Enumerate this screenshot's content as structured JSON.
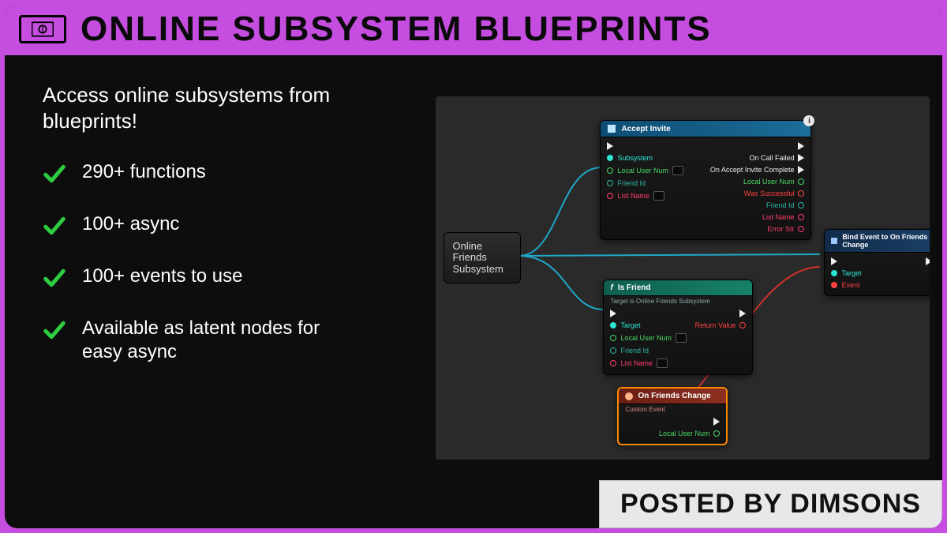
{
  "header": {
    "title": "ONLINE SUBSYSTEM BLUEPRINTS"
  },
  "tagline": "Access online subsystems from blueprints!",
  "features": [
    "290+ functions",
    "100+ async",
    "100+ events to use",
    "Available as latent nodes for easy async"
  ],
  "watermark": "POSTED BY DIMSONS",
  "graph": {
    "source_node": {
      "line1": "Online",
      "line2": "Friends",
      "line3": "Subsystem"
    },
    "accept": {
      "title": "Accept Invite",
      "in": [
        "Subsystem",
        "Local User Num",
        "Friend Id",
        "List Name"
      ],
      "out": [
        "On Call Failed",
        "On Accept Invite Complete",
        "Local User Num",
        "Was Successful",
        "Friend Id",
        "List Name",
        "Error Str"
      ]
    },
    "isfriend": {
      "title": "Is Friend",
      "sub": "Target is Online Friends Subsystem",
      "in": [
        "Target",
        "Local User Num",
        "Friend Id",
        "List Name"
      ],
      "out": [
        "Return Value"
      ]
    },
    "bind": {
      "title": "Bind Event to On Friends Change",
      "in": [
        "Target",
        "Event"
      ]
    },
    "event": {
      "title": "On Friends Change",
      "sub": "Custom Event",
      "out": [
        "Local User Num"
      ]
    }
  }
}
